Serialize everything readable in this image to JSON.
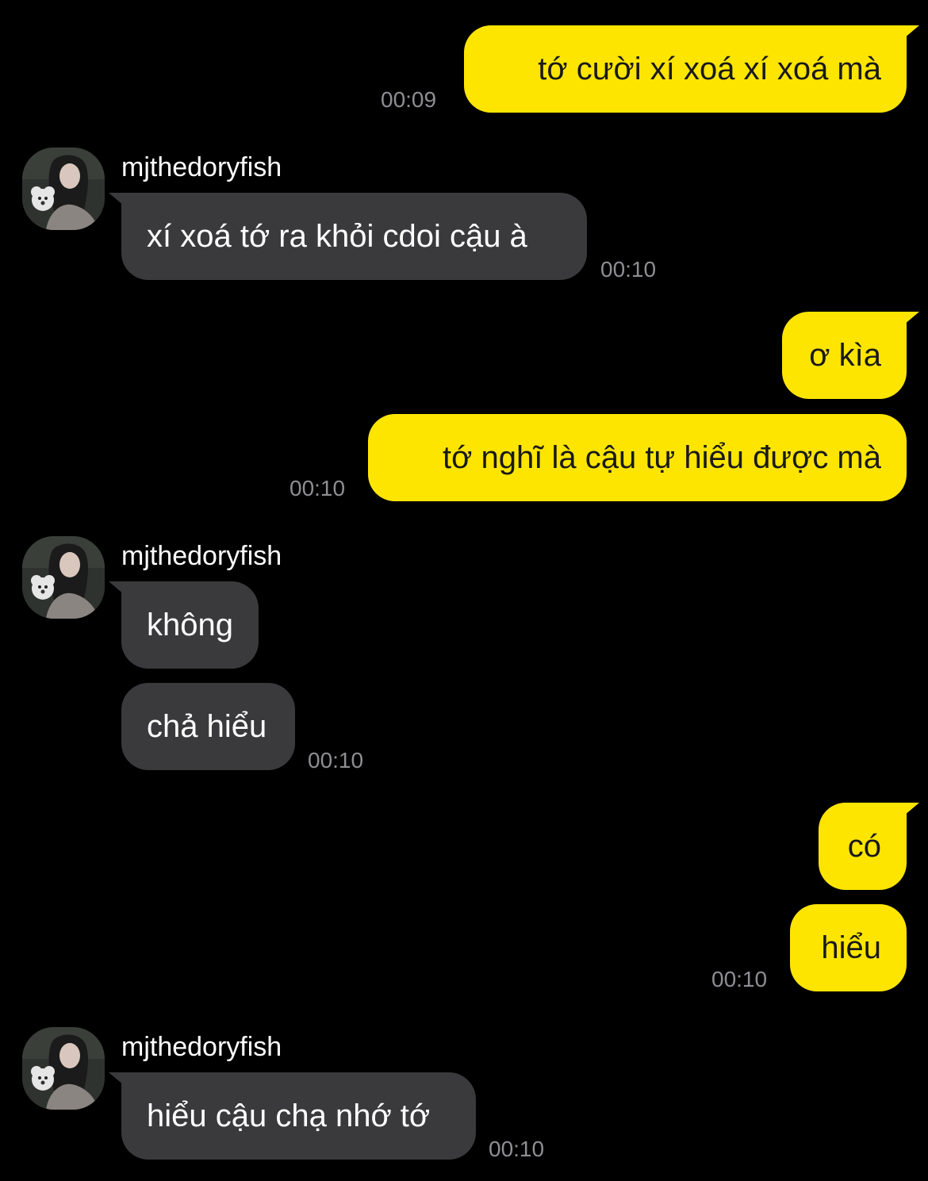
{
  "contact": {
    "name": "mjthedoryfish",
    "avatar_icon": "profile-photo-avatar"
  },
  "colors": {
    "background": "#000000",
    "outgoing_bubble": "#FEE500",
    "incoming_bubble": "#3A3A3C",
    "timestamp": "#8E8E93"
  },
  "messages": [
    {
      "from": "me",
      "text": "tớ cười xí xoá xí xoá mà",
      "time": "00:09"
    },
    {
      "from": "contact",
      "sender": "mjthedoryfish",
      "text": "xí xoá tớ ra khỏi cdoi cậu à",
      "time": "00:10"
    },
    {
      "from": "me",
      "text": "ơ kìa"
    },
    {
      "from": "me",
      "text": "tớ nghĩ là cậu tự hiểu được mà",
      "time": "00:10"
    },
    {
      "from": "contact",
      "sender": "mjthedoryfish",
      "text": "không"
    },
    {
      "from": "contact",
      "text": "chả hiểu",
      "time": "00:10"
    },
    {
      "from": "me",
      "text": "có"
    },
    {
      "from": "me",
      "text": "hiểu",
      "time": "00:10"
    },
    {
      "from": "contact",
      "sender": "mjthedoryfish",
      "text": "hiểu cậu chạ nhớ tớ",
      "time": "00:10"
    }
  ]
}
